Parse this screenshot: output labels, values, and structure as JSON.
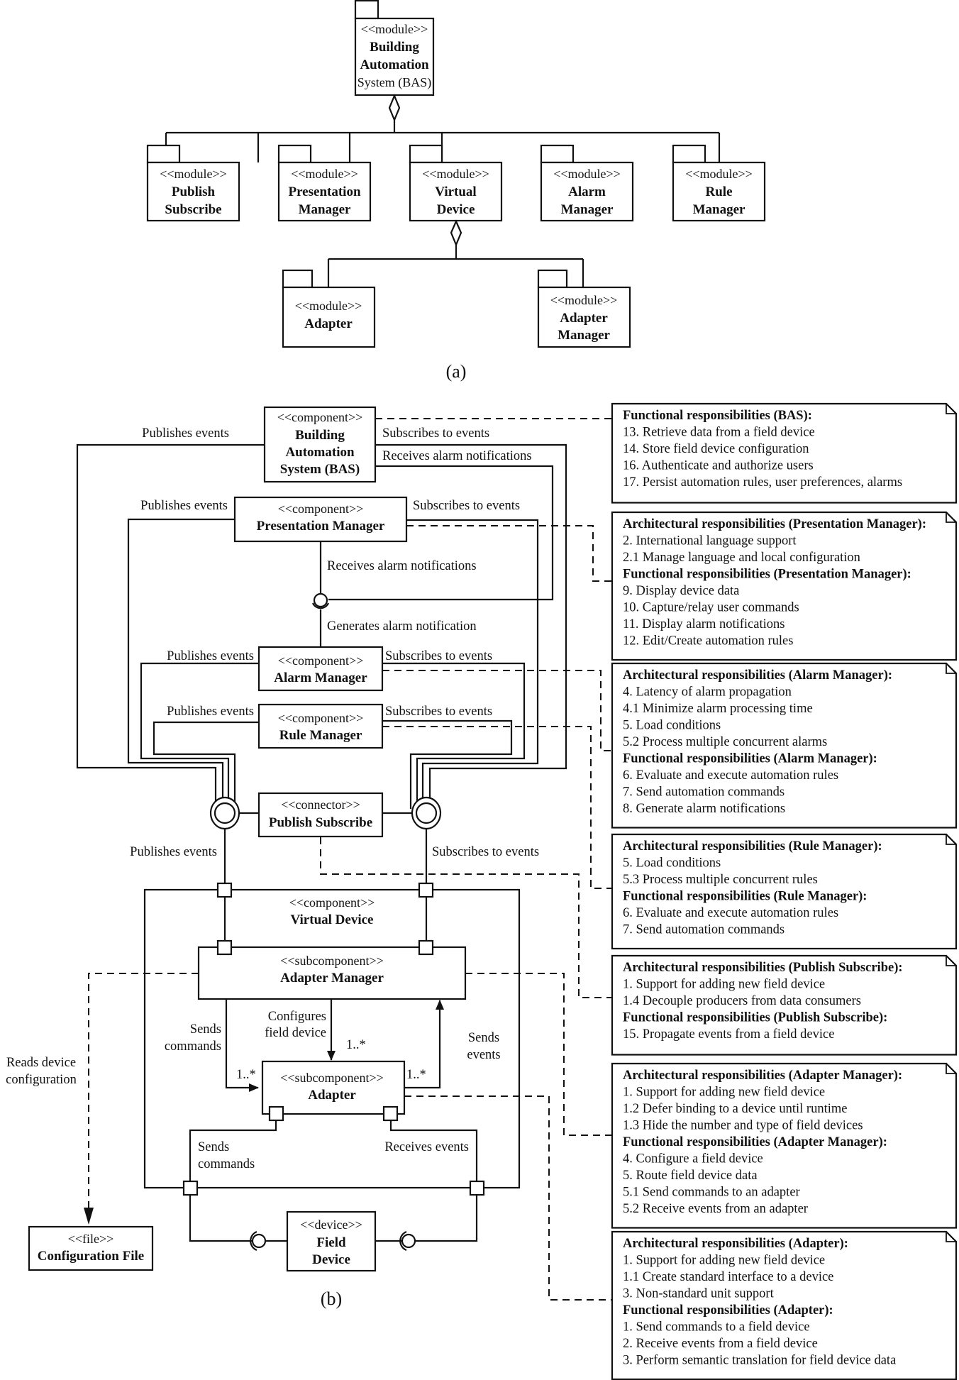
{
  "diagram_a": {
    "caption": "(a)",
    "root": {
      "stereotype": "<<module>>",
      "line1": "Building",
      "line2": "Automation",
      "line3": "System (BAS)"
    },
    "modules": [
      {
        "stereotype": "<<module>>",
        "line1": "Publish",
        "line2": "Subscribe"
      },
      {
        "stereotype": "<<module>>",
        "line1": "Presentation",
        "line2": "Manager"
      },
      {
        "stereotype": "<<module>>",
        "line1": "Virtual",
        "line2": "Device"
      },
      {
        "stereotype": "<<module>>",
        "line1": "Alarm",
        "line2": "Manager"
      },
      {
        "stereotype": "<<module>>",
        "line1": "Rule",
        "line2": "Manager"
      }
    ],
    "submodules": [
      {
        "stereotype": "<<module>>",
        "line1": "Adapter"
      },
      {
        "stereotype": "<<module>>",
        "line1": "Adapter",
        "line2": "Manager"
      }
    ]
  },
  "diagram_b": {
    "caption": "(b)",
    "bas": {
      "stereotype": "<<component>>",
      "line1": "Building",
      "line2": "Automation",
      "line3": "System (BAS)"
    },
    "presentation": {
      "stereotype": "<<component>>",
      "name": "Presentation Manager"
    },
    "alarm": {
      "stereotype": "<<component>>",
      "name": "Alarm Manager"
    },
    "rule": {
      "stereotype": "<<component>>",
      "name": "Rule Manager"
    },
    "pubsub": {
      "stereotype": "<<connector>>",
      "name": "Publish Subscribe"
    },
    "virtual_device": {
      "stereotype": "<<component>>",
      "name": "Virtual Device"
    },
    "adapter_manager": {
      "stereotype": "<<subcomponent>>",
      "name": "Adapter Manager"
    },
    "adapter": {
      "stereotype": "<<subcomponent>>",
      "name": "Adapter"
    },
    "field_device": {
      "stereotype": "<<device>>",
      "line1": "Field",
      "line2": "Device"
    },
    "config_file": {
      "stereotype": "<<file>>",
      "name": "Configuration File"
    },
    "labels": {
      "publishes_events": "Publishes events",
      "subscribes_to_events": "Subscribes to events",
      "receives_alarm_notifications": "Receives alarm notifications",
      "generates_alarm_notification": "Generates alarm notification",
      "sends": "Sends",
      "commands": "commands",
      "configures": "Configures",
      "field_device": "field device",
      "events": "events",
      "multiplicity": "1..*",
      "reads_device": "Reads device",
      "configuration": "configuration",
      "receives_events": "Receives events"
    },
    "notes": [
      {
        "id": "bas",
        "lines": [
          {
            "bold": true,
            "text": "Functional responsibilities (BAS):"
          },
          {
            "bold": false,
            "text": "13. Retrieve data from a field device"
          },
          {
            "bold": false,
            "text": "14. Store field device configuration"
          },
          {
            "bold": false,
            "text": "16. Authenticate and authorize users"
          },
          {
            "bold": false,
            "text": "17. Persist automation rules, user preferences, alarms"
          }
        ]
      },
      {
        "id": "presentation",
        "lines": [
          {
            "bold": true,
            "text": "Architectural responsibilities (Presentation Manager):"
          },
          {
            "bold": false,
            "text": "2. International language support"
          },
          {
            "bold": false,
            "text": "2.1 Manage language and local configuration"
          },
          {
            "bold": true,
            "text": "Functional responsibilities (Presentation Manager):"
          },
          {
            "bold": false,
            "text": "9. Display device data"
          },
          {
            "bold": false,
            "text": "10. Capture/relay user commands"
          },
          {
            "bold": false,
            "text": "11. Display alarm notifications"
          },
          {
            "bold": false,
            "text": "12. Edit/Create automation rules"
          }
        ]
      },
      {
        "id": "alarm",
        "lines": [
          {
            "bold": true,
            "text": "Architectural responsibilities (Alarm Manager):"
          },
          {
            "bold": false,
            "text": "4. Latency of alarm propagation"
          },
          {
            "bold": false,
            "text": "4.1 Minimize alarm processing time"
          },
          {
            "bold": false,
            "text": "5. Load conditions"
          },
          {
            "bold": false,
            "text": "5.2 Process multiple concurrent alarms"
          },
          {
            "bold": true,
            "text": "Functional responsibilities (Alarm Manager):"
          },
          {
            "bold": false,
            "text": "6. Evaluate and execute automation rules"
          },
          {
            "bold": false,
            "text": "7. Send automation commands"
          },
          {
            "bold": false,
            "text": "8. Generate alarm notifications"
          }
        ]
      },
      {
        "id": "rule",
        "lines": [
          {
            "bold": true,
            "text": "Architectural responsibilities (Rule Manager):"
          },
          {
            "bold": false,
            "text": "5. Load conditions"
          },
          {
            "bold": false,
            "text": "5.3 Process multiple concurrent rules"
          },
          {
            "bold": true,
            "text": "Functional responsibilities (Rule Manager):"
          },
          {
            "bold": false,
            "text": "6. Evaluate and execute automation rules"
          },
          {
            "bold": false,
            "text": "7. Send automation commands"
          }
        ]
      },
      {
        "id": "pubsub",
        "lines": [
          {
            "bold": true,
            "text": "Architectural responsibilities (Publish Subscribe):"
          },
          {
            "bold": false,
            "text": "1. Support for adding new field device"
          },
          {
            "bold": false,
            "text": "1.4 Decouple producers from data consumers"
          },
          {
            "bold": true,
            "text": "Functional responsibilities (Publish Subscribe):"
          },
          {
            "bold": false,
            "text": "15. Propagate events from a field device"
          }
        ]
      },
      {
        "id": "adapter_manager",
        "lines": [
          {
            "bold": true,
            "text": "Architectural responsibilities (Adapter Manager):"
          },
          {
            "bold": false,
            "text": "1. Support for adding new field device"
          },
          {
            "bold": false,
            "text": "1.2 Defer binding to a device until runtime"
          },
          {
            "bold": false,
            "text": "1.3 Hide the number and type of field devices"
          },
          {
            "bold": true,
            "text": "Functional responsibilities (Adapter Manager):"
          },
          {
            "bold": false,
            "text": "4. Configure a field device"
          },
          {
            "bold": false,
            "text": "5. Route field device data"
          },
          {
            "bold": false,
            "text": "5.1 Send commands to an adapter"
          },
          {
            "bold": false,
            "text": "5.2 Receive events from an adapter"
          }
        ]
      },
      {
        "id": "adapter",
        "lines": [
          {
            "bold": true,
            "text": "Architectural responsibilities (Adapter):"
          },
          {
            "bold": false,
            "text": "1. Support for adding new field device"
          },
          {
            "bold": false,
            "text": "1.1 Create standard interface to a device"
          },
          {
            "bold": false,
            "text": "3. Non-standard unit support"
          },
          {
            "bold": true,
            "text": "Functional responsibilities (Adapter):"
          },
          {
            "bold": false,
            "text": "1. Send commands to a field device"
          },
          {
            "bold": false,
            "text": "2. Receive events from a field device"
          },
          {
            "bold": false,
            "text": "3. Perform semantic translation for field device data"
          }
        ]
      }
    ]
  }
}
